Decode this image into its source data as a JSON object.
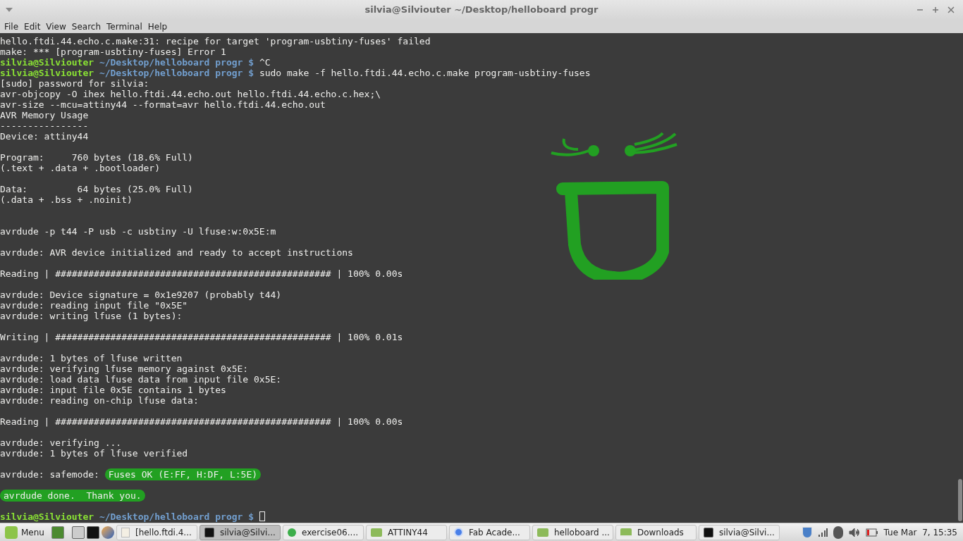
{
  "window": {
    "title": "silvia@Silviouter ~/Desktop/helloboard progr"
  },
  "menu": [
    "File",
    "Edit",
    "View",
    "Search",
    "Terminal",
    "Help"
  ],
  "terminal": {
    "lines": [
      {
        "kind": "text",
        "text": "hello.ftdi.44.echo.c.make:31: recipe for target 'program-usbtiny-fuses' failed"
      },
      {
        "kind": "text",
        "text": "make: *** [program-usbtiny-fuses] Error 1"
      },
      {
        "kind": "prompt",
        "user": "silvia@Silviouter",
        "path": "~/Desktop/helloboard progr $",
        "command": "^C"
      },
      {
        "kind": "prompt",
        "user": "silvia@Silviouter",
        "path": "~/Desktop/helloboard progr $",
        "command": "sudo make -f hello.ftdi.44.echo.c.make program-usbtiny-fuses"
      },
      {
        "kind": "text",
        "text": "[sudo] password for silvia:"
      },
      {
        "kind": "text",
        "text": "avr-objcopy -O ihex hello.ftdi.44.echo.out hello.ftdi.44.echo.c.hex;\\"
      },
      {
        "kind": "text",
        "text": "avr-size --mcu=attiny44 --format=avr hello.ftdi.44.echo.out"
      },
      {
        "kind": "text",
        "text": "AVR Memory Usage"
      },
      {
        "kind": "text",
        "text": "----------------"
      },
      {
        "kind": "text",
        "text": "Device: attiny44"
      },
      {
        "kind": "blank"
      },
      {
        "kind": "text",
        "text": "Program:     760 bytes (18.6% Full)"
      },
      {
        "kind": "text",
        "text": "(.text + .data + .bootloader)"
      },
      {
        "kind": "blank"
      },
      {
        "kind": "text",
        "text": "Data:         64 bytes (25.0% Full)"
      },
      {
        "kind": "text",
        "text": "(.data + .bss + .noinit)"
      },
      {
        "kind": "blank"
      },
      {
        "kind": "blank"
      },
      {
        "kind": "text",
        "text": "avrdude -p t44 -P usb -c usbtiny -U lfuse:w:0x5E:m"
      },
      {
        "kind": "blank"
      },
      {
        "kind": "text",
        "text": "avrdude: AVR device initialized and ready to accept instructions"
      },
      {
        "kind": "blank"
      },
      {
        "kind": "text",
        "text": "Reading | ################################################## | 100% 0.00s"
      },
      {
        "kind": "blank"
      },
      {
        "kind": "text",
        "text": "avrdude: Device signature = 0x1e9207 (probably t44)"
      },
      {
        "kind": "text",
        "text": "avrdude: reading input file \"0x5E\""
      },
      {
        "kind": "text",
        "text": "avrdude: writing lfuse (1 bytes):"
      },
      {
        "kind": "blank"
      },
      {
        "kind": "text",
        "text": "Writing | ################################################## | 100% 0.01s"
      },
      {
        "kind": "blank"
      },
      {
        "kind": "text",
        "text": "avrdude: 1 bytes of lfuse written"
      },
      {
        "kind": "text",
        "text": "avrdude: verifying lfuse memory against 0x5E:"
      },
      {
        "kind": "text",
        "text": "avrdude: load data lfuse data from input file 0x5E:"
      },
      {
        "kind": "text",
        "text": "avrdude: input file 0x5E contains 1 bytes"
      },
      {
        "kind": "text",
        "text": "avrdude: reading on-chip lfuse data:"
      },
      {
        "kind": "blank"
      },
      {
        "kind": "text",
        "text": "Reading | ################################################## | 100% 0.00s"
      },
      {
        "kind": "blank"
      },
      {
        "kind": "text",
        "text": "avrdude: verifying ..."
      },
      {
        "kind": "text",
        "text": "avrdude: 1 bytes of lfuse verified"
      },
      {
        "kind": "blank"
      },
      {
        "kind": "highlight",
        "prefix": "avrdude: safemode: ",
        "text": "Fuses OK (E:FF, H:DF, L:5E)"
      },
      {
        "kind": "blank"
      },
      {
        "kind": "highlight",
        "text": "avrdude done.  Thank you."
      },
      {
        "kind": "blank"
      },
      {
        "kind": "cursor",
        "user": "silvia@Silviouter",
        "path": "~/Desktop/helloboard progr $"
      }
    ]
  },
  "taskbar": {
    "menu_label": "Menu",
    "windows": [
      {
        "kind": "document",
        "label": "[hello.ftdi.4...",
        "selected": false
      },
      {
        "kind": "terminal",
        "label": "silvia@Silvi...",
        "selected": true
      },
      {
        "kind": "globe",
        "label": "exercise06....",
        "selected": false
      },
      {
        "kind": "folder",
        "label": "ATTINY44",
        "selected": false
      },
      {
        "kind": "browser",
        "label": "Fab Acade...",
        "selected": false
      },
      {
        "kind": "folder",
        "label": "helloboard ...",
        "selected": false
      },
      {
        "kind": "download",
        "label": "Downloads",
        "selected": false
      },
      {
        "kind": "terminal",
        "label": "silvia@Silvi...",
        "selected": false
      }
    ],
    "clock": "Tue Mar  7, 15:35"
  }
}
